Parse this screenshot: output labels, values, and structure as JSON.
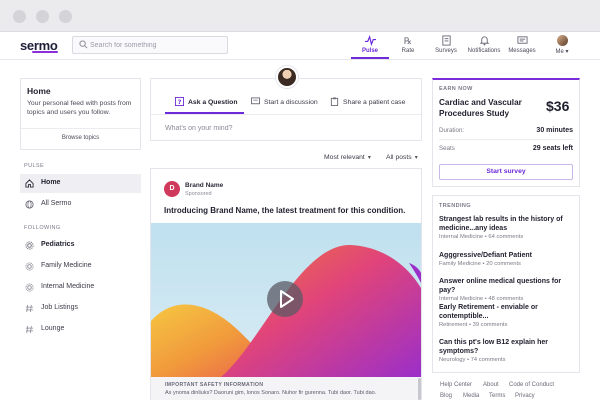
{
  "nav": {
    "logo": "sermo",
    "search_placeholder": "Search for something",
    "items": [
      {
        "label": "Pulse",
        "icon": "pulse-icon"
      },
      {
        "label": "Rate",
        "icon": "rate-icon"
      },
      {
        "label": "Surveys",
        "icon": "surveys-icon"
      },
      {
        "label": "Notifications",
        "icon": "bell-icon"
      },
      {
        "label": "Messages",
        "icon": "messages-icon"
      },
      {
        "label": "Me",
        "icon": "avatar-icon"
      }
    ]
  },
  "sidebar": {
    "home_title": "Home",
    "home_desc": "Your personal feed with posts from topics and users you follow.",
    "browse_topics": "Browse topics",
    "pulse_label": "PULSE",
    "pulse_items": [
      "Home",
      "All Sermo"
    ],
    "following_label": "FOLLOWING",
    "following_items": [
      "Pediatrics",
      "Family Medicine",
      "Internal Medicine",
      "Job Listings",
      "Lounge"
    ]
  },
  "composer": {
    "tabs": [
      "Ask a Question",
      "Start a discussion",
      "Share a patient case"
    ],
    "placeholder": "What's on your mind?"
  },
  "feed": {
    "sort_label": "Most relevant",
    "filter_label": "All posts"
  },
  "post": {
    "avatar_letter": "D",
    "brand_name": "Brand Name",
    "sponsored": "Sponsored",
    "title": "Introducing Brand Name, the latest treatment for this condition.",
    "safety_title": "IMPORTANT SAFETY INFORMATION",
    "safety_text": "As ynoma dinliuks? Daoruni gim, lonos Sonaro. Nuhor fir gurenna. Tubi daor. Tubi dao."
  },
  "earn": {
    "label": "EARN NOW",
    "title": "Cardiac and Vascular Procedures Study",
    "amount": "$36",
    "duration_key": "Duration:",
    "duration_val": "30 minutes",
    "seats_key": "Seats",
    "seats_val": "29 seats left",
    "button": "Start survey"
  },
  "trending": {
    "label": "TRENDING",
    "items": [
      {
        "title": "Strangest lab results in the history of medicine...any ideas",
        "topic": "Internal Medicine",
        "comments": "64 comments"
      },
      {
        "title": "Agggressive/Defiant Patient",
        "topic": "Family Medicine",
        "comments": "20 comments"
      },
      {
        "title": "Answer online medical questions for pay?",
        "topic": "Internal Medicine",
        "comments": "48 comments"
      },
      {
        "title": "Early Retirement - enviable or contemptible...",
        "topic": "Retirement",
        "comments": "39 comments"
      },
      {
        "title": "Can this pt's low B12 explain her symptoms?",
        "topic": "Neurology",
        "comments": "74 comments"
      }
    ]
  },
  "footer": {
    "row1": [
      "Help Center",
      "About",
      "Code of Conduct"
    ],
    "row2": [
      "Blog",
      "Media",
      "Terms",
      "Privacy"
    ]
  },
  "colors": {
    "accent": "#6c2bd9",
    "brand_avatar": "#cf3a5c"
  }
}
